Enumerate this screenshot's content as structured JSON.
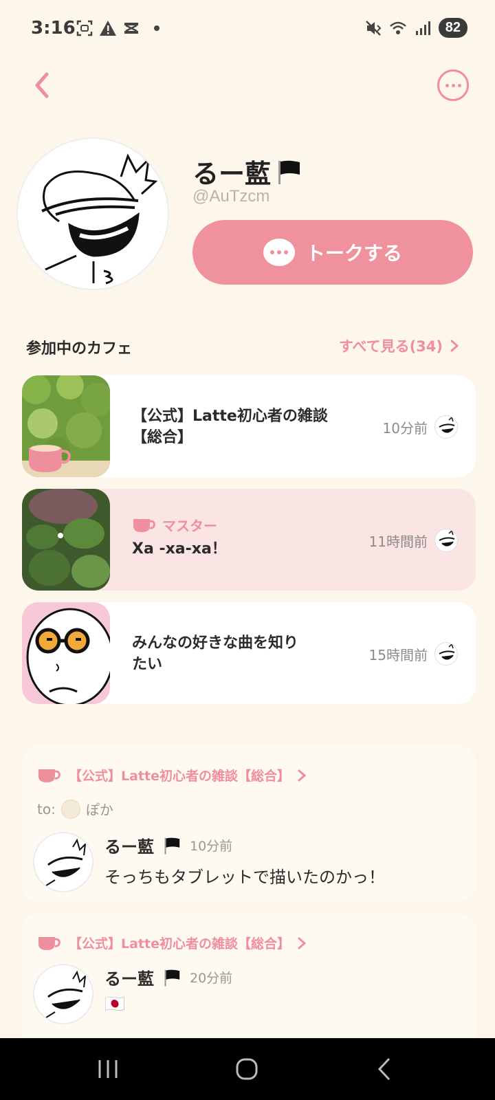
{
  "status": {
    "time": "3:16",
    "battery": "82",
    "icons_left": [
      "screenshot-icon",
      "warning-icon",
      "app-icon",
      "dot-icon"
    ],
    "icons_right": [
      "mute-icon",
      "wifi-icon",
      "signal-icon"
    ]
  },
  "header": {
    "back_icon": "chevron-left-icon",
    "more_icon": "more-horizontal-icon"
  },
  "profile": {
    "name": "るー藍",
    "flag_icon": "black-flag-icon",
    "handle": "@AuTzcm",
    "talk_button": "トークする"
  },
  "cafes_section": {
    "title": "参加中のカフェ",
    "see_all": "すべて見る(34)"
  },
  "cafes": [
    {
      "title_line1": "【公式】Latte初心者の雑談",
      "title_line2": "【総合】",
      "time": "10分前",
      "master": ""
    },
    {
      "title_line1": "Xa -xa-xa！",
      "title_line2": "",
      "time": "11時間前",
      "master": "マスター"
    },
    {
      "title_line1": "みんなの好きな曲を知り",
      "title_line2": "たい",
      "time": "15時間前",
      "master": ""
    }
  ],
  "posts": [
    {
      "cafe": "【公式】Latte初心者の雑談【総合】",
      "to_label": "to:",
      "to_name": "ぽか",
      "author": "るー藍",
      "time": "10分前",
      "text": "そっちもタブレットで描いたのかっ！"
    },
    {
      "cafe": "【公式】Latte初心者の雑談【総合】",
      "author": "るー藍",
      "time": "20分前",
      "text": "🇯🇵"
    }
  ],
  "colors": {
    "accent": "#f0919e",
    "background": "#fdf6ea",
    "card_active": "#fbe4e4"
  }
}
